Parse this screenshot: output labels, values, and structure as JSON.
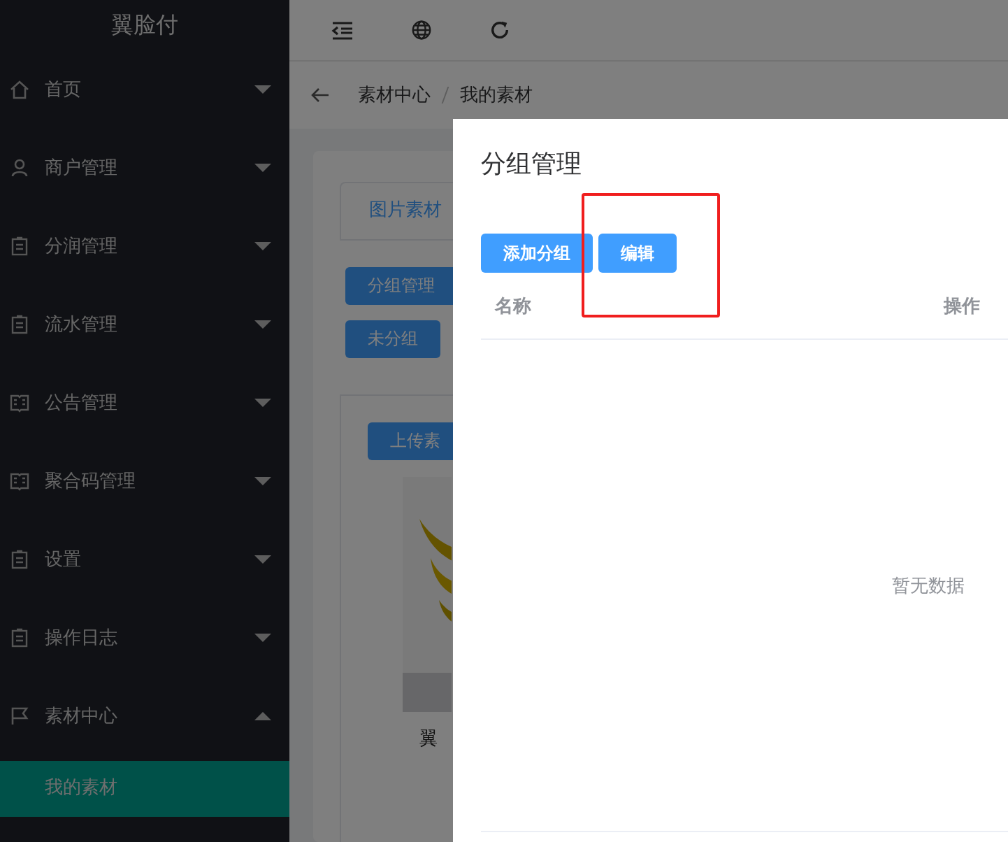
{
  "sidebar": {
    "title": "翼脸付",
    "items": [
      {
        "label": "首页",
        "expanded": false
      },
      {
        "label": "商户管理",
        "expanded": false
      },
      {
        "label": "分润管理",
        "expanded": false
      },
      {
        "label": "流水管理",
        "expanded": false
      },
      {
        "label": "公告管理",
        "expanded": false
      },
      {
        "label": "聚合码管理",
        "expanded": false
      },
      {
        "label": "设置",
        "expanded": false
      },
      {
        "label": "操作日志",
        "expanded": false
      },
      {
        "label": "素材中心",
        "expanded": true,
        "children": [
          {
            "label": "我的素材",
            "selected": true
          }
        ]
      }
    ]
  },
  "breadcrumb": [
    "素材中心",
    "我的素材"
  ],
  "tabs": [
    {
      "label": "图片素材",
      "selected": true
    }
  ],
  "group_buttons": [
    "分组管理",
    "未分组"
  ],
  "upload_button": "上传素",
  "material": {
    "kind": "picture",
    "caption": "翼"
  },
  "dialog": {
    "title": "分组管理",
    "buttons": [
      "添加分组",
      "编辑"
    ],
    "columns": [
      "名称",
      "操作"
    ],
    "empty_text": "暂无数据"
  }
}
